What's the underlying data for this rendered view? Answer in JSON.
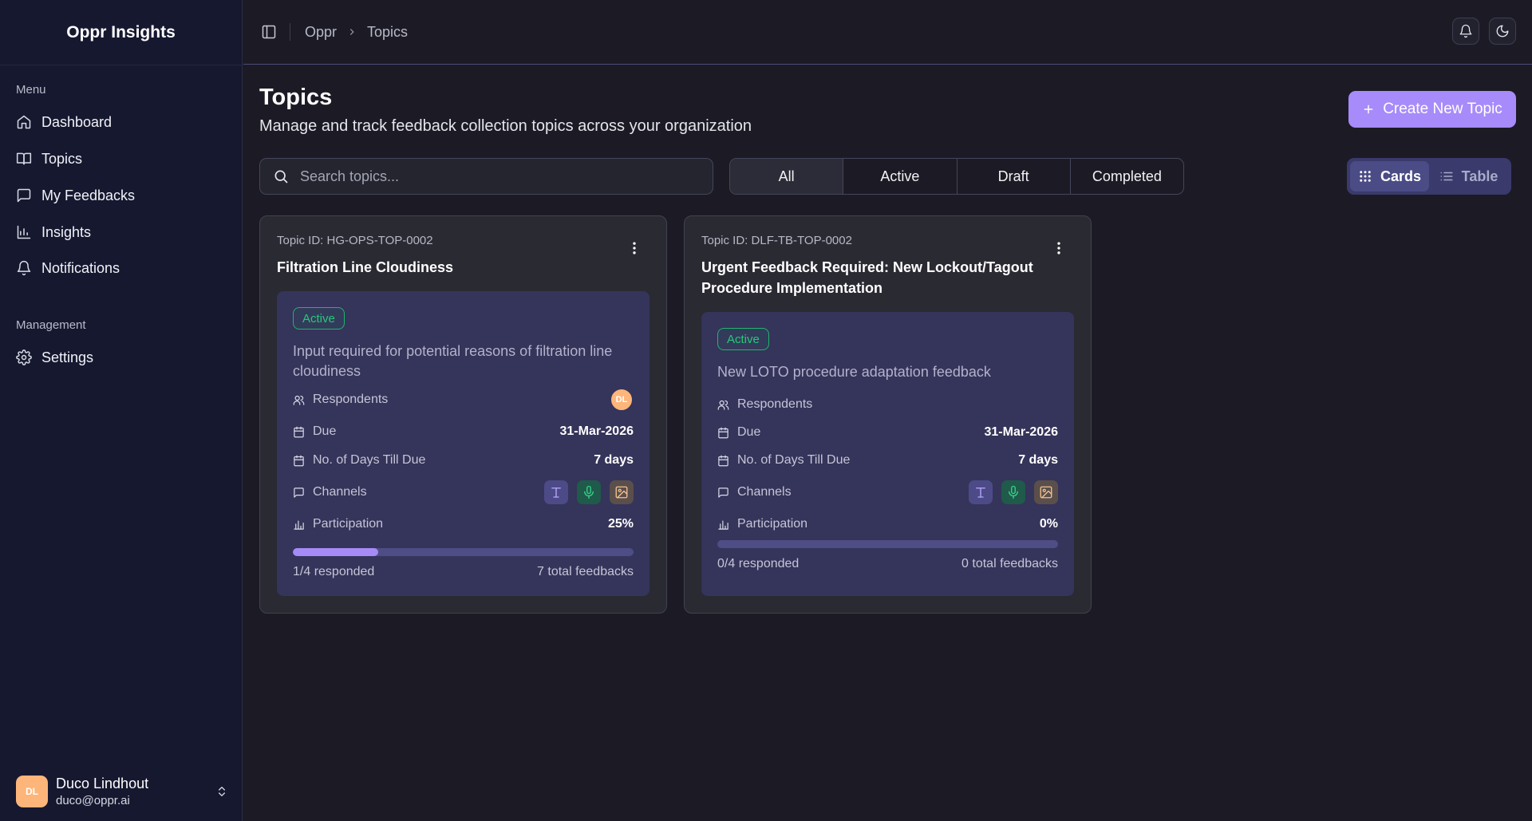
{
  "app": {
    "title": "Oppr Insights"
  },
  "sidebar": {
    "menu_label": "Menu",
    "items": [
      {
        "label": "Dashboard",
        "icon": "home-icon"
      },
      {
        "label": "Topics",
        "icon": "book-icon"
      },
      {
        "label": "My Feedbacks",
        "icon": "message-square-icon"
      },
      {
        "label": "Insights",
        "icon": "bar-chart-icon"
      },
      {
        "label": "Notifications",
        "icon": "bell-icon"
      }
    ],
    "management_label": "Management",
    "management_items": [
      {
        "label": "Settings",
        "icon": "gear-icon"
      }
    ],
    "user": {
      "initials": "DL",
      "name": "Duco Lindhout",
      "email": "duco@oppr.ai"
    }
  },
  "header": {
    "breadcrumb": [
      "Oppr",
      "Topics"
    ]
  },
  "page": {
    "title": "Topics",
    "subtitle": "Manage and track feedback collection topics across your organization",
    "create_label": "Create New Topic"
  },
  "search": {
    "placeholder": "Search topics..."
  },
  "filters": [
    "All",
    "Active",
    "Draft",
    "Completed"
  ],
  "selected_filter": "All",
  "view_toggle": {
    "cards_label": "Cards",
    "table_label": "Table",
    "active": "Cards"
  },
  "labels": {
    "respondents": "Respondents",
    "due": "Due",
    "days_till_due": "No. of Days Till Due",
    "channels": "Channels",
    "participation": "Participation"
  },
  "topics": [
    {
      "id_text": "Topic ID: HG-OPS-TOP-0002",
      "title": "Filtration Line Cloudiness",
      "status": "Active",
      "description": "Input required for potential reasons of filtration line cloudiness",
      "respondent_initials": "DL",
      "due": "31-Mar-2026",
      "days_till_due": "7 days",
      "channels": [
        "text",
        "voice",
        "image"
      ],
      "participation": "25%",
      "participation_fraction": 0.25,
      "responded": "1/4 responded",
      "total_feedbacks": "7 total feedbacks"
    },
    {
      "id_text": "Topic ID: DLF-TB-TOP-0002",
      "title": "Urgent Feedback Required: New Lockout/Tagout Procedure Implementation",
      "status": "Active",
      "description": "New LOTO procedure adaptation feedback",
      "respondent_initials": "",
      "due": "31-Mar-2026",
      "days_till_due": "7 days",
      "channels": [
        "text",
        "voice",
        "image"
      ],
      "participation": "0%",
      "participation_fraction": 0,
      "responded": "0/4 responded",
      "total_feedbacks": "0 total feedbacks"
    }
  ],
  "colors": {
    "accent": "#a78bfa",
    "active_badge": "#25c97a",
    "sidebar_bg": "#161830",
    "page_bg": "#1c1b25"
  }
}
